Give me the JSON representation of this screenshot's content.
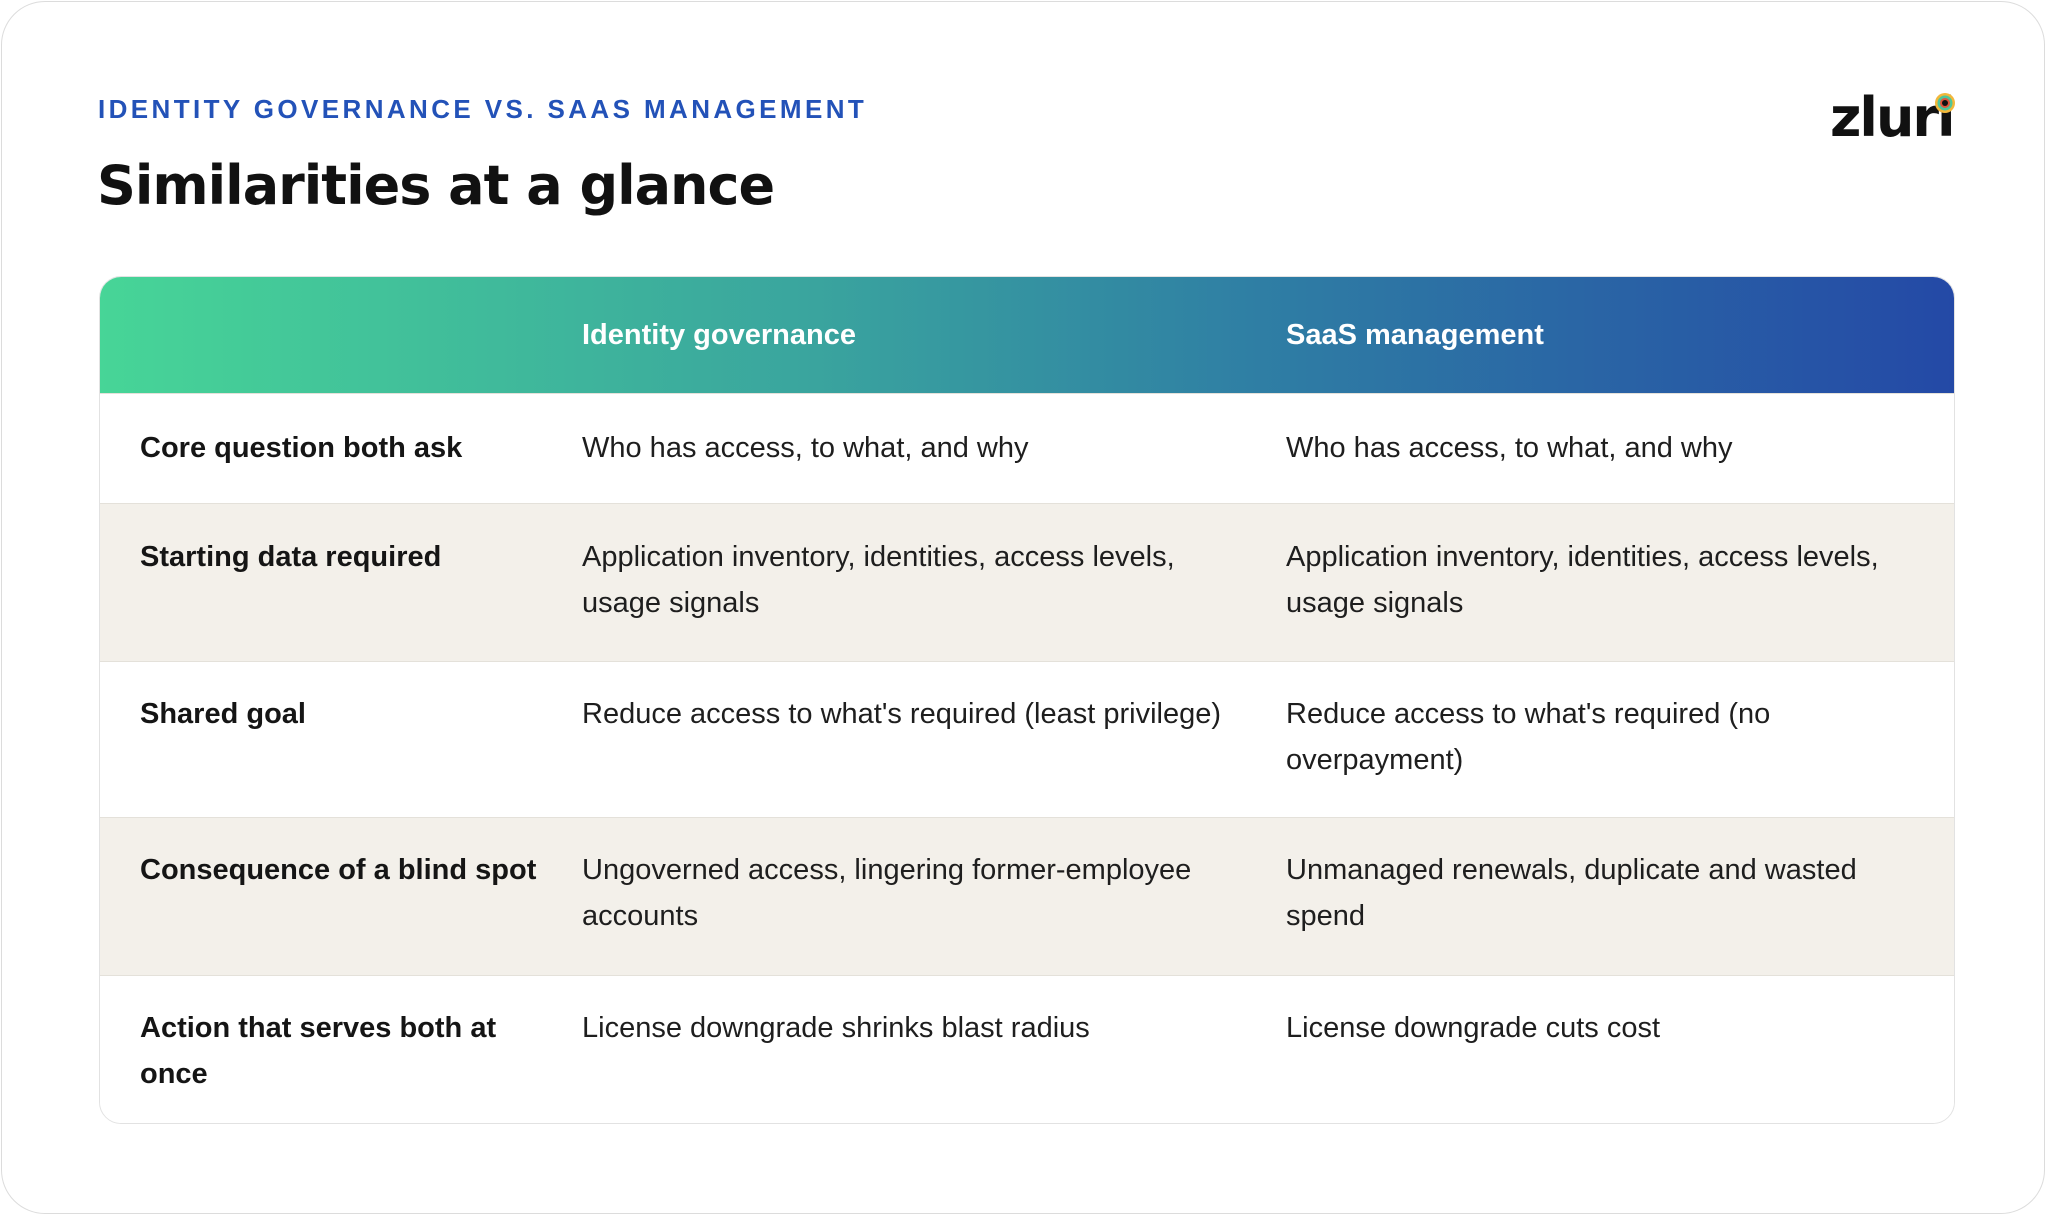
{
  "header": {
    "eyebrow": "IDENTITY GOVERNANCE VS. SAAS MANAGEMENT",
    "title": "Similarities at a glance",
    "logo_text": "zluri"
  },
  "colors": {
    "eyebrow": "#2352b8",
    "header_gradient_start": "#47d597",
    "header_gradient_end": "#2449a6",
    "alt_row": "#f3f0ea"
  },
  "table": {
    "columns": [
      "",
      "Identity governance",
      "SaaS management"
    ],
    "rows": [
      {
        "label": "Core question both ask",
        "identity": "Who has access, to what, and why",
        "saas": "Who has access, to what, and why"
      },
      {
        "label": "Starting data required",
        "identity": "Application inventory, identities, access levels, usage signals",
        "saas": "Application inventory, identities, access levels, usage signals"
      },
      {
        "label": "Shared goal",
        "identity": "Reduce access to what's required (least privilege)",
        "saas": "Reduce access to what's required (no overpayment)"
      },
      {
        "label": "Consequence of a blind spot",
        "identity": "Ungoverned access, lingering former-employee accounts",
        "saas": "Unmanaged renewals, duplicate and wasted spend"
      },
      {
        "label": "Action that serves both at once",
        "identity": "License downgrade shrinks blast radius",
        "saas": "License downgrade cuts cost"
      }
    ]
  }
}
